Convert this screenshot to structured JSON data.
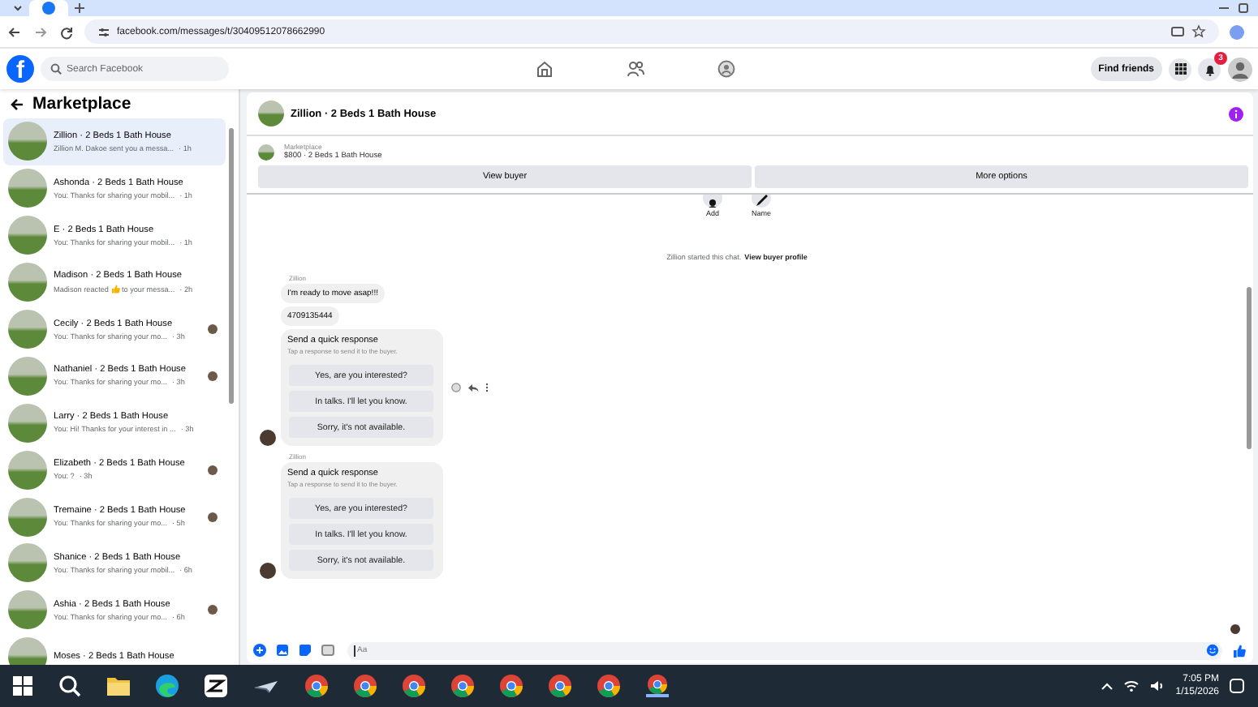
{
  "browser": {
    "url": "facebook.com/messages/t/30409512078662990"
  },
  "topnav": {
    "logo": "f",
    "search": {
      "placeholder": "Search Facebook"
    },
    "find_friends": "Find friends",
    "notifications": "3"
  },
  "sidebar": {
    "title": "Marketplace",
    "conversations": [
      {
        "title": "Zillion · 2 Beds 1 Bath House",
        "preview": "Zillion M. Dakoe sent you a messa...",
        "time": "· 1h",
        "selected": true,
        "seen": false
      },
      {
        "title": "Ashonda · 2 Beds 1 Bath House",
        "preview": "You: Thanks for sharing your mobil...",
        "time": "· 1h",
        "selected": false,
        "seen": false
      },
      {
        "title": "E · 2 Beds 1 Bath House",
        "preview": "You: Thanks for sharing your mobil...",
        "time": "· 1h",
        "selected": false,
        "seen": false
      },
      {
        "title": "Madison · 2 Beds 1 Bath House",
        "preview": "Madison reacted",
        "preview_after": "to your messa...",
        "time": "· 2h",
        "selected": false,
        "seen": false
      },
      {
        "title": "Cecily · 2 Beds 1 Bath House",
        "preview": "You: Thanks for sharing your mo...",
        "time": "· 3h",
        "selected": false,
        "seen": true
      },
      {
        "title": "Nathaniel · 2 Beds 1 Bath House",
        "preview": "You: Thanks for sharing your mo...",
        "time": "· 3h",
        "selected": false,
        "seen": true
      },
      {
        "title": "Larry · 2 Beds 1 Bath House",
        "preview": "You: Hi! Thanks for your interest in ...",
        "time": "· 3h",
        "selected": false,
        "seen": false
      },
      {
        "title": "Elizabeth · 2 Beds 1 Bath House",
        "preview": "You: ?",
        "time": "· 3h",
        "selected": false,
        "seen": true
      },
      {
        "title": "Tremaine · 2 Beds 1 Bath House",
        "preview": "You: Thanks for sharing your mo...",
        "time": "· 5h",
        "selected": false,
        "seen": true
      },
      {
        "title": "Shanice · 2 Beds 1 Bath House",
        "preview": "You: Thanks for sharing your mobil...",
        "time": "· 6h",
        "selected": false,
        "seen": false
      },
      {
        "title": "Ashia · 2 Beds 1 Bath House",
        "preview": "You: Thanks for sharing your mo...",
        "time": "· 6h",
        "selected": false,
        "seen": true
      },
      {
        "title": "Moses · 2 Beds 1 Bath House",
        "selected": false,
        "seen": false
      }
    ]
  },
  "chat": {
    "title": "Zillion · 2 Beds 1 Bath House",
    "listing": {
      "label": "Marketplace",
      "item": "$800 · 2 Beds 1 Bath House",
      "buttons": [
        "View buyer",
        "More options"
      ]
    },
    "quick_actions": [
      "Add",
      "Name"
    ],
    "notice": {
      "text": "Zillion started this chat.",
      "link": "View buyer profile"
    },
    "groups": [
      {
        "sender": "Zillion",
        "actions": true,
        "items": [
          {
            "kind": "text",
            "text": "I'm ready to move asap!!!"
          },
          {
            "kind": "text",
            "text": "4709135444"
          },
          {
            "kind": "quick_response",
            "title": "Send a quick response",
            "subtitle": "Tap a response to send it to the buyer.",
            "options": [
              "Yes, are you interested?",
              "In talks. I'll let you know.",
              "Sorry, it's not available."
            ]
          }
        ]
      },
      {
        "sender": "Zillion",
        "actions": false,
        "items": [
          {
            "kind": "quick_response",
            "title": "Send a quick response",
            "subtitle": "Tap a response to send it to the buyer.",
            "options": [
              "Yes, are you interested?",
              "In talks. I'll let you know.",
              "Sorry, it's not available."
            ]
          }
        ]
      }
    ],
    "composer": {
      "placeholder": "Aa"
    }
  },
  "taskbar": {
    "time": "7:05 PM",
    "date": "1/15/2026"
  }
}
